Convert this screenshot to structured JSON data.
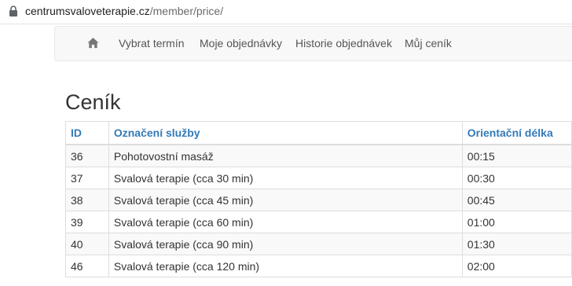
{
  "browser": {
    "url_host": "centrumsvaloveterapie.cz",
    "url_path": "/member/price/"
  },
  "icons": {
    "lock": "lock-icon",
    "home": "home-icon"
  },
  "nav": {
    "items": [
      {
        "label": "Vybrat termín"
      },
      {
        "label": "Moje objednávky"
      },
      {
        "label": "Historie objednávek"
      },
      {
        "label": "Můj ceník"
      }
    ]
  },
  "page": {
    "title": "Ceník"
  },
  "table": {
    "headers": {
      "id": "ID",
      "name": "Označení služby",
      "length": "Orientační délka"
    },
    "rows": [
      {
        "id": "36",
        "name": "Pohotovostní masáž",
        "length": "00:15"
      },
      {
        "id": "37",
        "name": "Svalová terapie (cca 30 min)",
        "length": "00:30"
      },
      {
        "id": "38",
        "name": "Svalová terapie (cca 45 min)",
        "length": "00:45"
      },
      {
        "id": "39",
        "name": "Svalová terapie (cca 60 min)",
        "length": "01:00"
      },
      {
        "id": "40",
        "name": "Svalová terapie (cca 90 min)",
        "length": "01:30"
      },
      {
        "id": "46",
        "name": "Svalová terapie (cca 120 min)",
        "length": "02:00"
      }
    ]
  },
  "colors": {
    "link_blue": "#337ab7",
    "nav_bg": "#f8f8f8",
    "stripe": "#f9f9f9"
  }
}
